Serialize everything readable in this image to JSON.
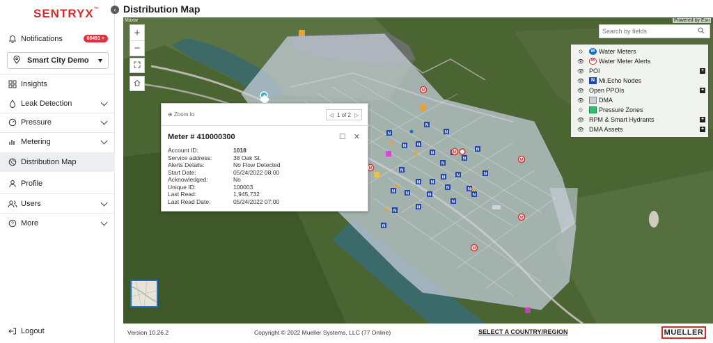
{
  "app": {
    "brand": "SENTRYX",
    "brand_tm": "™",
    "page_title": "Distribution Map"
  },
  "sidebar": {
    "notifications": {
      "label": "Notifications",
      "badge": "68491 +"
    },
    "project": "Smart City Demo",
    "items": [
      {
        "label": "Insights",
        "icon": "grid-icon"
      },
      {
        "label": "Leak Detection",
        "icon": "drop-icon"
      },
      {
        "label": "Pressure",
        "icon": "gauge-icon"
      },
      {
        "label": "Metering",
        "icon": "bars-icon"
      },
      {
        "label": "Distribution Map",
        "icon": "globe-icon"
      },
      {
        "label": "Profile",
        "icon": "user-icon"
      },
      {
        "label": "Users",
        "icon": "users-icon"
      },
      {
        "label": "More",
        "icon": "help-icon"
      }
    ],
    "logout": "Logout"
  },
  "map": {
    "imagery_credit": "Maxar",
    "powered_by": "Powered by Esri",
    "search_placeholder": "Search by fields",
    "zoom_in": "+",
    "zoom_out": "−"
  },
  "layers": [
    {
      "label": "Water Meters",
      "visible": false,
      "icon": "meter-blue",
      "glyph": "M"
    },
    {
      "label": "Water Meter Alerts",
      "visible": true,
      "icon": "meter-red",
      "glyph": "M"
    },
    {
      "label": "POI",
      "visible": true,
      "icon": "",
      "expandable": true
    },
    {
      "label": "Mi.Echo Nodes",
      "visible": true,
      "icon": "node-blue",
      "glyph": "N"
    },
    {
      "label": "Open PPOIs",
      "visible": true,
      "icon": "",
      "expandable": true
    },
    {
      "label": "DMA",
      "visible": true,
      "icon": "square-gray"
    },
    {
      "label": "Pressure Zones",
      "visible": false,
      "icon": "square-green"
    },
    {
      "label": "RPM & Smart Hydrants",
      "visible": true,
      "icon": "",
      "expandable": true
    },
    {
      "label": "DMA Assets",
      "visible": true,
      "icon": "",
      "expandable": true
    }
  ],
  "popup": {
    "zoom_to": "Zoom to",
    "pager": "1 of 2",
    "title": "Meter # 410000300",
    "fields": [
      {
        "key": "Account ID:",
        "value": "1018",
        "bold": true
      },
      {
        "key": "Service address:",
        "value": "38 Oak St."
      },
      {
        "key": "Alerts Details:",
        "value": "No Flow Detected"
      },
      {
        "key": "Start Date:",
        "value": "05/24/2022 08:00"
      },
      {
        "key": "Acknowledged:",
        "value": "No"
      },
      {
        "key": "Unique ID:",
        "value": "100003"
      },
      {
        "key": "Last Read:",
        "value": "1,945,732"
      },
      {
        "key": "Last Read Date:",
        "value": "05/24/2022 07:00"
      }
    ]
  },
  "footer": {
    "version": "Version 10.26.2",
    "copyright": "Copyright © 2022 Mueller Systems, LLC (77 Online)",
    "region": "SELECT A COUNTRY/REGION",
    "brand": "MUELLER"
  },
  "colors": {
    "brand_red": "#d42a2a",
    "dma_fill": "#c8d0dc",
    "node_blue": "#2247a8",
    "meter_blue": "#1e6fc2",
    "alert_red": "#d62f2f"
  }
}
